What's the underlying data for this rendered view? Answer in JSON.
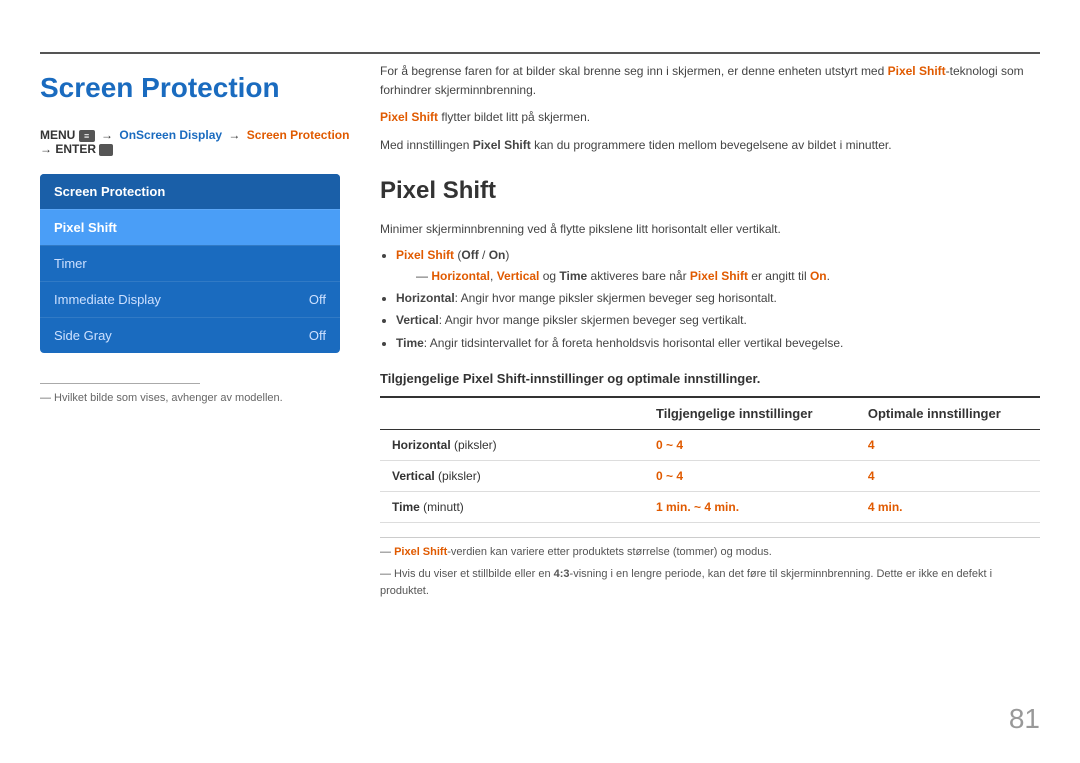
{
  "page": {
    "number": "81",
    "top_rule": true
  },
  "left": {
    "title": "Screen Protection",
    "breadcrumb": {
      "parts": [
        {
          "text": "MENU ",
          "style": "bold"
        },
        {
          "text": "→ ",
          "style": "normal"
        },
        {
          "text": "OnScreen Display",
          "style": "highlight"
        },
        {
          "text": " → ",
          "style": "normal"
        },
        {
          "text": "Screen Protection",
          "style": "orange"
        },
        {
          "text": " → ENTER ",
          "style": "bold"
        }
      ],
      "full": "MENU □□ → OnScreen Display → Screen Protection → ENTER □"
    },
    "menu": {
      "header": "Screen Protection",
      "items": [
        {
          "label": "Pixel Shift",
          "value": "",
          "active": true
        },
        {
          "label": "Timer",
          "value": "",
          "active": false
        },
        {
          "label": "Immediate Display",
          "value": "Off",
          "active": false
        },
        {
          "label": "Side Gray",
          "value": "Off",
          "active": false
        }
      ]
    },
    "footnote": "― Hvilket bilde som vises, avhenger av modellen."
  },
  "right": {
    "intro_lines": [
      "For å begrense faren for at bilder skal brenne seg inn i skjermen, er denne enheten utstyrt med Pixel Shift-teknologi som forhindrer skjerminnbrenning.",
      "Pixel Shift flytter bildet litt på skjermen.",
      "Med innstillingen Pixel Shift kan du programmere tiden mellom bevegelsene av bildet i minutter."
    ],
    "section_title": "Pixel Shift",
    "description": "Minimer skjerminnbrenning ved å flytte pikslene litt horisontalt eller vertikalt.",
    "bullets": [
      {
        "text": "Pixel Shift (Off / On)",
        "sub": "Horizontal, Vertical og Time aktiveres bare når Pixel Shift er angitt til On."
      },
      {
        "text": "Horizontal: Angir hvor mange piksler skjermen beveger seg horisontalt.",
        "sub": null
      },
      {
        "text": "Vertical: Angir hvor mange piksler skjermen beveger seg vertikalt.",
        "sub": null
      },
      {
        "text": "Time: Angir tidsintervallet for å foreta henholdsvis horisontal eller vertikal bevegelse.",
        "sub": null
      }
    ],
    "table_title": "Tilgjengelige Pixel Shift-innstillinger og optimale innstillinger.",
    "table": {
      "headers": [
        "",
        "Tilgjengelige innstillinger",
        "Optimale innstillinger"
      ],
      "rows": [
        {
          "col1": "Horizontal (piksler)",
          "col1_bold": "Horizontal",
          "col1_rest": " (piksler)",
          "col2": "0 ~ 4",
          "col3": "4"
        },
        {
          "col1": "Vertical (piksler)",
          "col1_bold": "Vertical",
          "col1_rest": " (piksler)",
          "col2": "0 ~ 4",
          "col3": "4"
        },
        {
          "col1": "Time (minutt)",
          "col1_bold": "Time",
          "col1_rest": " (minutt)",
          "col2": "1 min. ~ 4 min.",
          "col3": "4 min."
        }
      ]
    },
    "footnotes": [
      "― Pixel Shift-verdien kan variere etter produktets størrelse (tommer) og modus.",
      "― Hvis du viser et stillbilde eller en 4:3-visning i en lengre periode, kan det føre til skjerminnbrenning. Dette er ikke en defekt i produktet."
    ]
  }
}
